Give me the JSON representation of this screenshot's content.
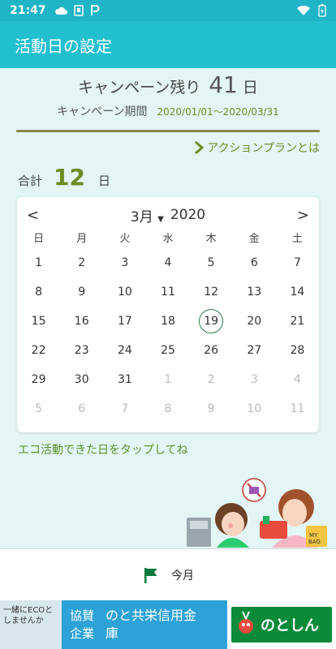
{
  "status_bar": {
    "time": "21:47",
    "icons": [
      "cloud-icon",
      "sim-icon",
      "parking-icon",
      "wifi-icon",
      "battery-icon"
    ]
  },
  "app_bar": {
    "title": "活動日の設定"
  },
  "campaign": {
    "remaining_label": "キャンペーン残り",
    "remaining_days": "41",
    "remaining_unit": "日",
    "period_label": "キャンペーン期間",
    "period_value": "2020/01/01～2020/03/31"
  },
  "action_link": {
    "label": "アクションプランとは"
  },
  "total": {
    "label": "合計",
    "value": "12",
    "unit": "日"
  },
  "calendar": {
    "prev": "<",
    "next": ">",
    "month": "3月",
    "year": "2020",
    "weekdays": [
      "日",
      "月",
      "火",
      "水",
      "木",
      "金",
      "土"
    ],
    "days": [
      [
        "1",
        "2",
        "3",
        "4",
        "5",
        "6",
        "7"
      ],
      [
        "8",
        "9",
        "10",
        "11",
        "12",
        "13",
        "14"
      ],
      [
        "15",
        "16",
        "17",
        "18",
        "19",
        "20",
        "21"
      ],
      [
        "22",
        "23",
        "24",
        "25",
        "26",
        "27",
        "28"
      ],
      [
        "29",
        "30",
        "31",
        "1",
        "2",
        "3",
        "4"
      ],
      [
        "5",
        "6",
        "7",
        "8",
        "9",
        "10",
        "11"
      ]
    ],
    "today": "19"
  },
  "tap_hint": "エコ活動できた日をタップしてね",
  "bottom_panel": {
    "label": "今月"
  },
  "ad": {
    "left_text_1": "一緒にECOと",
    "left_text_2": "しませんか",
    "kyosan_1": "協賛",
    "kyosan_2": "企業",
    "name_1": "のと共栄信用金",
    "name_2": "庫",
    "logo_text": "のとしん"
  },
  "colors": {
    "app_bar": "#22bfcf",
    "accent": "#6b8e23",
    "background": "#e3f5f5"
  }
}
